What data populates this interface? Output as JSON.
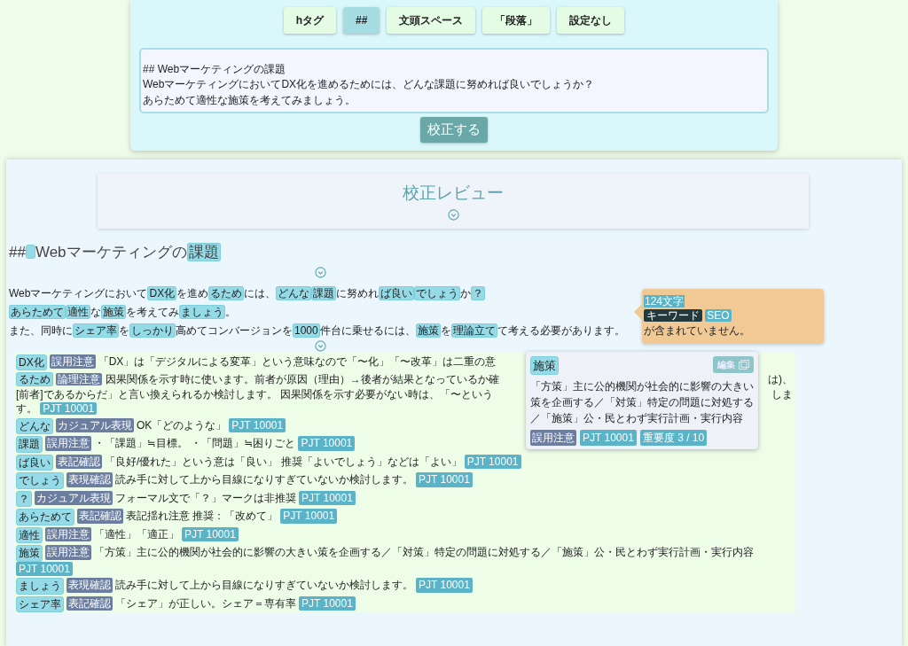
{
  "format_buttons": [
    {
      "label": "hタグ",
      "selected": false
    },
    {
      "label": "##",
      "selected": true
    },
    {
      "label": "文頭スペース",
      "selected": false
    },
    {
      "label": "「段落」",
      "selected": false
    },
    {
      "label": "設定なし",
      "selected": false
    }
  ],
  "editor": {
    "lines": [
      "## Webマーケティングの課題",
      "WebマーケティングにおいてDX化を進めるためには、どんな課題に努めれば良いでしょうか？",
      "あらためて適性な施策を考えてみましょう。"
    ]
  },
  "submit_button": "校正する",
  "review": {
    "title": "校正レビュー",
    "heading": [
      {
        "t": "##",
        "hl": false
      },
      {
        "kind": "gap",
        "hl": true
      },
      {
        "t": "Webマーケティングの",
        "hl": false
      },
      {
        "t": "課題",
        "hl": true
      }
    ],
    "paragraph": [
      [
        {
          "t": "Webマーケティングにおいて",
          "hl": false
        },
        {
          "t": "DX化",
          "hl": true
        },
        {
          "t": "を進め",
          "hl": false
        },
        {
          "t": "るため",
          "hl": true
        },
        {
          "t": "には、",
          "hl": false
        },
        {
          "t": "どんな",
          "hl": true
        },
        {
          "t": "課題",
          "hl": true
        },
        {
          "t": "に努めれ",
          "hl": false
        },
        {
          "t": "ば良い",
          "hl": true
        },
        {
          "t": "でしょう",
          "hl": true
        },
        {
          "t": "か",
          "hl": false
        },
        {
          "t": "？",
          "hl": true
        }
      ],
      [
        {
          "t": "あらためて",
          "hl": true
        },
        {
          "t": "適性",
          "hl": true
        },
        {
          "t": "な",
          "hl": false
        },
        {
          "t": "施策",
          "hl": true
        },
        {
          "t": "を考えてみ",
          "hl": false
        },
        {
          "t": "ましょう",
          "hl": true
        },
        {
          "t": "。",
          "hl": false
        }
      ],
      [
        {
          "t": "また、同時に",
          "hl": false
        },
        {
          "t": "シェア率",
          "hl": true
        },
        {
          "t": "を",
          "hl": false
        },
        {
          "t": "しっかり",
          "hl": true
        },
        {
          "t": "高めてコンバージョンを",
          "hl": false
        },
        {
          "t": "1000",
          "hl": true
        },
        {
          "t": "件台に乗せるには、",
          "hl": false
        },
        {
          "t": "施策",
          "hl": true
        },
        {
          "t": "を",
          "hl": false
        },
        {
          "t": "理論立て",
          "hl": true
        },
        {
          "t": "て考える必要があります。",
          "hl": false
        }
      ]
    ],
    "summary": {
      "count": "124文字",
      "label": "キーワード",
      "keyword": "SEO",
      "message": "が含まれていません。"
    },
    "issues": [
      {
        "kind": "plain",
        "word": "DX化",
        "category": "誤用注意",
        "text": "「DX」は「デジタルによる変革」という意味なので「〜化」「〜改革」は二重の意"
      },
      {
        "kind": "covered",
        "word": "るため",
        "category": "論理注意",
        "lines": [
          {
            "left": "因果関係を示す時に使います。前者が原因（理由）→後者が結果となっているか確",
            "right": "は)、"
          },
          {
            "left": "[前者]であるからだ」と言い換えられるか検討します。 因果関係を示す必要がない時は、「〜という",
            "right": "しま"
          },
          {
            "left": "す。"
          }
        ],
        "code": "PJT 10001"
      },
      {
        "kind": "plain",
        "word": "どんな",
        "category": "カジュアル表現",
        "text": "OK「どのような」",
        "code": "PJT 10001"
      },
      {
        "kind": "plain",
        "word": "課題",
        "category": "誤用注意",
        "text": "・「課題」≒目標。 ・「問題」≒困りごと",
        "code": "PJT 10001"
      },
      {
        "kind": "plain",
        "word": "ば良い",
        "category": "表記確認",
        "text": "「良好/優れた」という意は「良い」 推奨「よいでしょう」などは「よい」",
        "code": "PJT 10001"
      },
      {
        "kind": "plain",
        "word": "でしょう",
        "category": "表現確認",
        "text": "読み手に対して上から目線になりすぎていないか検討します。",
        "code": "PJT 10001"
      },
      {
        "kind": "plain",
        "word": "？",
        "category": "カジュアル表現",
        "text": "フォーマル文で「？」マークは非推奨",
        "code": "PJT 10001"
      },
      {
        "kind": "plain",
        "word": "あらためて",
        "category": "表記確認",
        "text": "表記揺れ注意 推奨：「改めて」",
        "code": "PJT 10001"
      },
      {
        "kind": "plain",
        "word": "適性",
        "category": "誤用注意",
        "text": "「適性」「適正」",
        "code": "PJT 10001"
      },
      {
        "kind": "plain",
        "word": "施策",
        "category": "誤用注意",
        "text": "「方策」主に公的機関が社会的に影響の大きい策を企画する／「対策」特定の問題に対処する／「施策」公・民とわず実行計画・実行内容",
        "code": "PJT 10001"
      },
      {
        "kind": "plain",
        "word": "ましょう",
        "category": "表現確認",
        "text": "読み手に対して上から目線になりすぎていないか検討します。",
        "code": "PJT 10001"
      },
      {
        "kind": "plain",
        "word": "シェア率",
        "category": "表記確認",
        "text": "「シェア」が正しい。シェア＝専有率",
        "code": "PJT 10001"
      }
    ],
    "popover": {
      "word": "施策",
      "edit_button": "編集",
      "text": "「方策」主に公的機関が社会的に影響の大きい策を企画する／「対策」特定の問題に対処する／「施策」公・民とわず実行計画・実行内容",
      "category": "誤用注意",
      "code": "PJT 10001",
      "importance": "重要度 3 / 10"
    }
  }
}
